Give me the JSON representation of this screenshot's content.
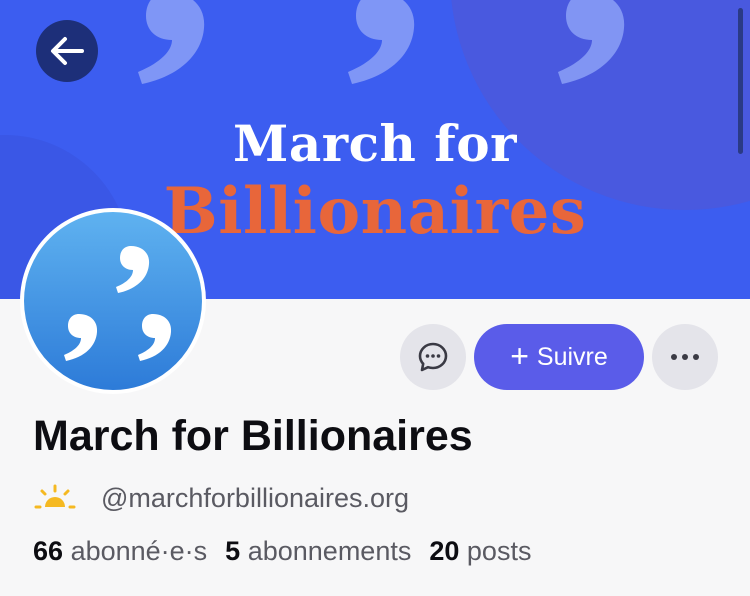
{
  "banner": {
    "title_line1": "March for",
    "title_line2": "Billionaires",
    "colors": {
      "background": "#3c5df0",
      "title1": "#ffffff",
      "title2": "#e8663a"
    }
  },
  "header": {
    "back_icon": "arrow-left-icon"
  },
  "profile": {
    "display_name": "March for Billionaires",
    "handle": "@marchforbillionaires.org",
    "handle_icon": "sunrise-icon",
    "stats": {
      "followers_count": "66",
      "followers_label": "abonné·e·s",
      "following_count": "5",
      "following_label": "abonnements",
      "posts_count": "20",
      "posts_label": "posts"
    }
  },
  "actions": {
    "message_icon": "chat-bubble-icon",
    "follow_label": "Suivre",
    "follow_icon": "plus-icon",
    "more_icon": "ellipsis-icon",
    "accent_color": "#5a5ce9"
  }
}
